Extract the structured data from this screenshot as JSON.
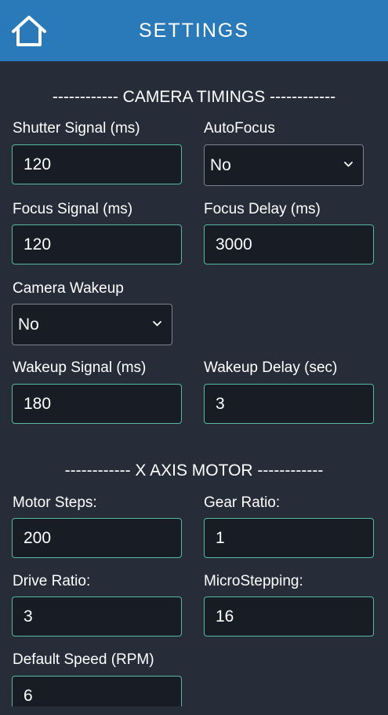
{
  "header": {
    "title": "SETTINGS",
    "home_icon": "home-icon"
  },
  "camera_section": {
    "title": "------------ CAMERA TIMINGS ------------",
    "shutter_signal": {
      "label": "Shutter Signal (ms)",
      "value": "120"
    },
    "autofocus": {
      "label": "AutoFocus",
      "value": "No"
    },
    "focus_signal": {
      "label": "Focus Signal (ms)",
      "value": "120"
    },
    "focus_delay": {
      "label": "Focus Delay (ms)",
      "value": "3000"
    },
    "camera_wakeup": {
      "label": "Camera Wakeup",
      "value": "No"
    },
    "wakeup_signal": {
      "label": "Wakeup Signal (ms)",
      "value": "180"
    },
    "wakeup_delay": {
      "label": "Wakeup Delay (sec)",
      "value": "3"
    }
  },
  "x_axis_section": {
    "title": "------------ X AXIS MOTOR ------------",
    "motor_steps": {
      "label": "Motor Steps:",
      "value": "200"
    },
    "gear_ratio": {
      "label": "Gear Ratio:",
      "value": "1"
    },
    "drive_ratio": {
      "label": "Drive Ratio:",
      "value": "3"
    },
    "microstepping": {
      "label": "MicroStepping:",
      "value": "16"
    },
    "default_speed": {
      "label": "Default Speed (RPM)",
      "value": "6"
    }
  },
  "colors": {
    "header_bg": "#2a79b8",
    "page_bg": "#262c38",
    "input_bg": "#181c24",
    "input_border": "#56b9a3"
  }
}
